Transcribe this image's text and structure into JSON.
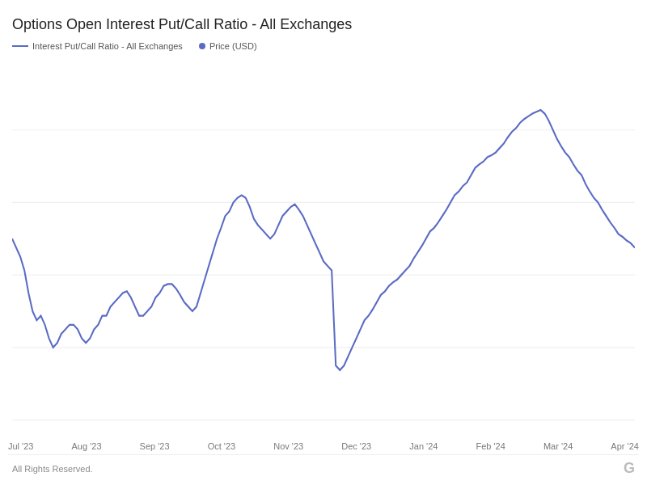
{
  "page": {
    "title": "Options Open Interest Put/Call Ratio - All Exchanges",
    "legend": [
      {
        "label": "Interest Put/Call Ratio - All Exchanges",
        "type": "line"
      },
      {
        "label": "Price (USD)",
        "type": "dot"
      }
    ],
    "xAxis": {
      "labels": [
        "Jul '23",
        "Aug '23",
        "Sep '23",
        "Oct '23",
        "Nov '23",
        "Dec '23",
        "Jan '24",
        "Feb '24",
        "Mar '24",
        "Apr '24"
      ]
    },
    "footer": {
      "copyright": "All Rights Reserved.",
      "logo": "G"
    },
    "chart": {
      "lineColor": "#5a6bc4",
      "gridColor": "#f0f0f0"
    }
  }
}
